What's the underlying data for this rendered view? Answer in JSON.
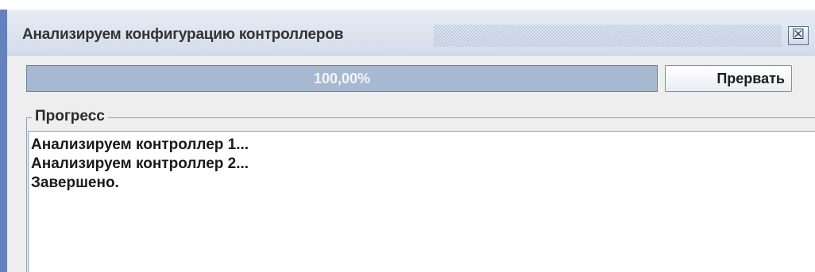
{
  "window": {
    "title": "Анализируем конфигурацию контроллеров",
    "close_icon": "close-icon"
  },
  "progress": {
    "value": 1.0,
    "label": "100,00%",
    "abort_label": "Прервать"
  },
  "log_group": {
    "title": "Прогресс",
    "lines": [
      "Анализируем контроллер 1...",
      "Анализируем контроллер 2...",
      "Завершено."
    ]
  },
  "colors": {
    "accent": "#6382bf",
    "progress_fill": "#a7b8d1",
    "titlebar": "#dbe3ef"
  }
}
